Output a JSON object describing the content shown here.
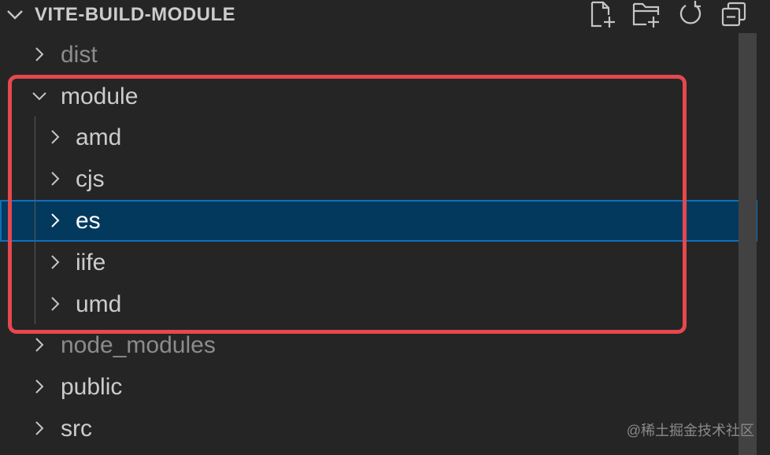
{
  "explorer": {
    "section_title": "VITE-BUILD-MODULE",
    "actions": [
      {
        "name": "new-file-icon",
        "label": "New File"
      },
      {
        "name": "new-folder-icon",
        "label": "New Folder"
      },
      {
        "name": "refresh-icon",
        "label": "Refresh Explorer"
      },
      {
        "name": "collapse-all-icon",
        "label": "Collapse Folders in Explorer"
      }
    ],
    "tree": [
      {
        "label": "dist",
        "expanded": false,
        "depth": 0,
        "dimmed": true
      },
      {
        "label": "module",
        "expanded": true,
        "depth": 0
      },
      {
        "label": "amd",
        "expanded": false,
        "depth": 1
      },
      {
        "label": "cjs",
        "expanded": false,
        "depth": 1
      },
      {
        "label": "es",
        "expanded": false,
        "depth": 1,
        "selected": true
      },
      {
        "label": "iife",
        "expanded": false,
        "depth": 1
      },
      {
        "label": "umd",
        "expanded": false,
        "depth": 1
      },
      {
        "label": "node_modules",
        "expanded": false,
        "depth": 0,
        "dimmed": true
      },
      {
        "label": "public",
        "expanded": false,
        "depth": 0
      },
      {
        "label": "src",
        "expanded": false,
        "depth": 0
      }
    ]
  },
  "watermark": "@稀土掘金技术社区",
  "colors": {
    "background": "#252526",
    "selection": "#04395e",
    "selection_border": "#0f6fb8",
    "annotation": "#e5484d"
  }
}
